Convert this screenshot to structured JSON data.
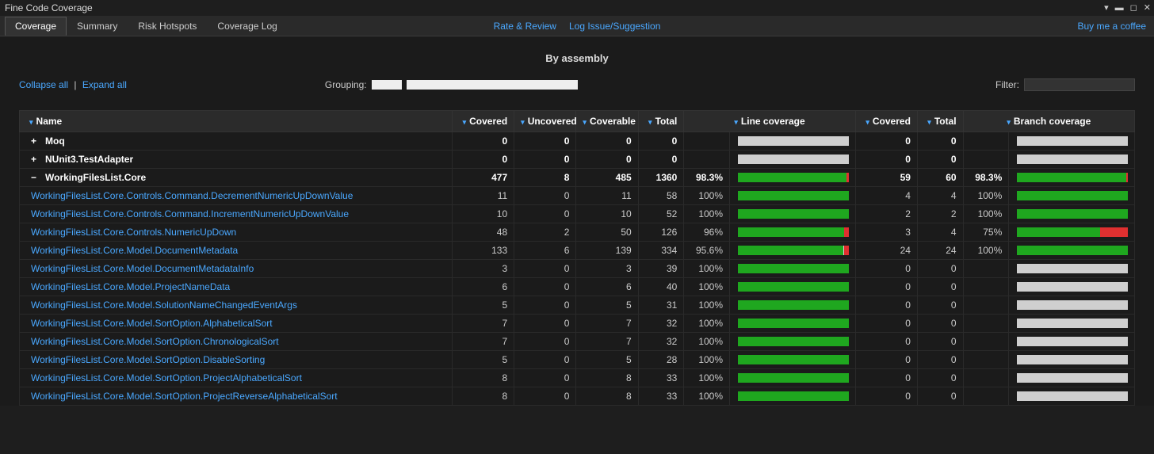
{
  "window": {
    "title": "Fine Code Coverage"
  },
  "tabs": [
    {
      "label": "Coverage",
      "active": true
    },
    {
      "label": "Summary",
      "active": false
    },
    {
      "label": "Risk Hotspots",
      "active": false
    },
    {
      "label": "Coverage Log",
      "active": false
    }
  ],
  "links": {
    "rate": "Rate & Review",
    "issue": "Log Issue/Suggestion",
    "coffee": "Buy me a coffee"
  },
  "heading": "By assembly",
  "controls": {
    "collapse": "Collapse all",
    "expand": "Expand all",
    "grouping_label": "Grouping:",
    "filter_label": "Filter:",
    "filter_value": ""
  },
  "columns": {
    "name": "Name",
    "covered": "Covered",
    "uncovered": "Uncovered",
    "coverable": "Coverable",
    "total": "Total",
    "line_cov": "Line coverage",
    "b_covered": "Covered",
    "b_total": "Total",
    "branch_cov": "Branch coverage"
  },
  "rows": [
    {
      "type": "group",
      "toggle": "+",
      "name": "Moq",
      "covered": "0",
      "uncovered": "0",
      "coverable": "0",
      "total": "0",
      "linePct": "",
      "lineBar": null,
      "bCovered": "0",
      "bTotal": "0",
      "branchPct": "",
      "branchBar": null
    },
    {
      "type": "group",
      "toggle": "+",
      "name": "NUnit3.TestAdapter",
      "covered": "0",
      "uncovered": "0",
      "coverable": "0",
      "total": "0",
      "linePct": "",
      "lineBar": null,
      "bCovered": "0",
      "bTotal": "0",
      "branchPct": "",
      "branchBar": null
    },
    {
      "type": "group",
      "toggle": "−",
      "name": "WorkingFilesList.Core",
      "covered": "477",
      "uncovered": "8",
      "coverable": "485",
      "total": "1360",
      "linePct": "98.3%",
      "lineBar": 98.3,
      "bCovered": "59",
      "bTotal": "60",
      "branchPct": "98.3%",
      "branchBar": 98.3
    },
    {
      "type": "child",
      "name": "WorkingFilesList.Core.Controls.Command.DecrementNumericUpDownValue",
      "covered": "11",
      "uncovered": "0",
      "coverable": "11",
      "total": "58",
      "linePct": "100%",
      "lineBar": 100,
      "bCovered": "4",
      "bTotal": "4",
      "branchPct": "100%",
      "branchBar": 100
    },
    {
      "type": "child",
      "name": "WorkingFilesList.Core.Controls.Command.IncrementNumericUpDownValue",
      "covered": "10",
      "uncovered": "0",
      "coverable": "10",
      "total": "52",
      "linePct": "100%",
      "lineBar": 100,
      "bCovered": "2",
      "bTotal": "2",
      "branchPct": "100%",
      "branchBar": 100
    },
    {
      "type": "child",
      "name": "WorkingFilesList.Core.Controls.NumericUpDown",
      "covered": "48",
      "uncovered": "2",
      "coverable": "50",
      "total": "126",
      "linePct": "96%",
      "lineBar": 96,
      "bCovered": "3",
      "bTotal": "4",
      "branchPct": "75%",
      "branchBar": 75
    },
    {
      "type": "child",
      "name": "WorkingFilesList.Core.Model.DocumentMetadata",
      "covered": "133",
      "uncovered": "6",
      "coverable": "139",
      "total": "334",
      "linePct": "95.6%",
      "lineBar": 95.6,
      "bCovered": "24",
      "bTotal": "24",
      "branchPct": "100%",
      "branchBar": 100
    },
    {
      "type": "child",
      "name": "WorkingFilesList.Core.Model.DocumentMetadataInfo",
      "covered": "3",
      "uncovered": "0",
      "coverable": "3",
      "total": "39",
      "linePct": "100%",
      "lineBar": 100,
      "bCovered": "0",
      "bTotal": "0",
      "branchPct": "",
      "branchBar": null
    },
    {
      "type": "child",
      "name": "WorkingFilesList.Core.Model.ProjectNameData",
      "covered": "6",
      "uncovered": "0",
      "coverable": "6",
      "total": "40",
      "linePct": "100%",
      "lineBar": 100,
      "bCovered": "0",
      "bTotal": "0",
      "branchPct": "",
      "branchBar": null
    },
    {
      "type": "child",
      "name": "WorkingFilesList.Core.Model.SolutionNameChangedEventArgs",
      "covered": "5",
      "uncovered": "0",
      "coverable": "5",
      "total": "31",
      "linePct": "100%",
      "lineBar": 100,
      "bCovered": "0",
      "bTotal": "0",
      "branchPct": "",
      "branchBar": null
    },
    {
      "type": "child",
      "name": "WorkingFilesList.Core.Model.SortOption.AlphabeticalSort",
      "covered": "7",
      "uncovered": "0",
      "coverable": "7",
      "total": "32",
      "linePct": "100%",
      "lineBar": 100,
      "bCovered": "0",
      "bTotal": "0",
      "branchPct": "",
      "branchBar": null
    },
    {
      "type": "child",
      "name": "WorkingFilesList.Core.Model.SortOption.ChronologicalSort",
      "covered": "7",
      "uncovered": "0",
      "coverable": "7",
      "total": "32",
      "linePct": "100%",
      "lineBar": 100,
      "bCovered": "0",
      "bTotal": "0",
      "branchPct": "",
      "branchBar": null
    },
    {
      "type": "child",
      "name": "WorkingFilesList.Core.Model.SortOption.DisableSorting",
      "covered": "5",
      "uncovered": "0",
      "coverable": "5",
      "total": "28",
      "linePct": "100%",
      "lineBar": 100,
      "bCovered": "0",
      "bTotal": "0",
      "branchPct": "",
      "branchBar": null
    },
    {
      "type": "child",
      "name": "WorkingFilesList.Core.Model.SortOption.ProjectAlphabeticalSort",
      "covered": "8",
      "uncovered": "0",
      "coverable": "8",
      "total": "33",
      "linePct": "100%",
      "lineBar": 100,
      "bCovered": "0",
      "bTotal": "0",
      "branchPct": "",
      "branchBar": null
    },
    {
      "type": "child",
      "name": "WorkingFilesList.Core.Model.SortOption.ProjectReverseAlphabeticalSort",
      "covered": "8",
      "uncovered": "0",
      "coverable": "8",
      "total": "33",
      "linePct": "100%",
      "lineBar": 100,
      "bCovered": "0",
      "bTotal": "0",
      "branchPct": "",
      "branchBar": null
    }
  ]
}
